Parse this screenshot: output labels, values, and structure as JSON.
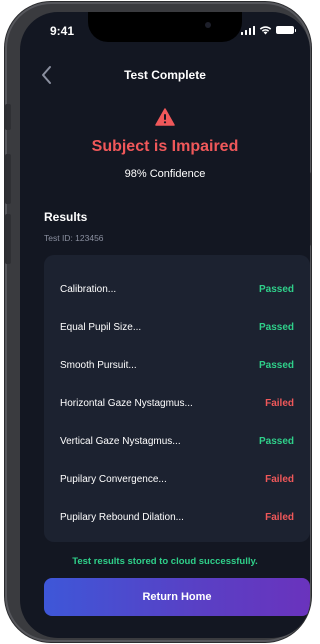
{
  "status_bar": {
    "time": "9:41"
  },
  "nav": {
    "title": "Test Complete"
  },
  "result": {
    "verdict": "Subject is Impaired",
    "confidence": "98% Confidence"
  },
  "results_section": {
    "title": "Results",
    "test_id": "Test ID: 123456",
    "items": [
      {
        "label": "Calibration...",
        "status": "Passed"
      },
      {
        "label": "Equal Pupil Size...",
        "status": "Passed"
      },
      {
        "label": "Smooth Pursuit...",
        "status": "Passed"
      },
      {
        "label": "Horizontal Gaze Nystagmus...",
        "status": "Failed"
      },
      {
        "label": "Vertical Gaze Nystagmus...",
        "status": "Passed"
      },
      {
        "label": "Pupilary Convergence...",
        "status": "Failed"
      },
      {
        "label": "Pupilary Rebound Dilation...",
        "status": "Failed"
      }
    ]
  },
  "footer": {
    "cloud_message": "Test results stored to cloud successfully.",
    "home_button": "Return Home"
  },
  "colors": {
    "background": "#131722",
    "card": "#1c2230",
    "passed": "#2fd08a",
    "failed": "#f0585a",
    "button_gradient_start": "#3e57d8",
    "button_gradient_end": "#6a33bd"
  },
  "icons": {
    "back": "chevron-left-icon",
    "warning": "warning-triangle-icon",
    "signal": "cellular-signal-icon",
    "wifi": "wifi-icon",
    "battery": "battery-icon"
  }
}
